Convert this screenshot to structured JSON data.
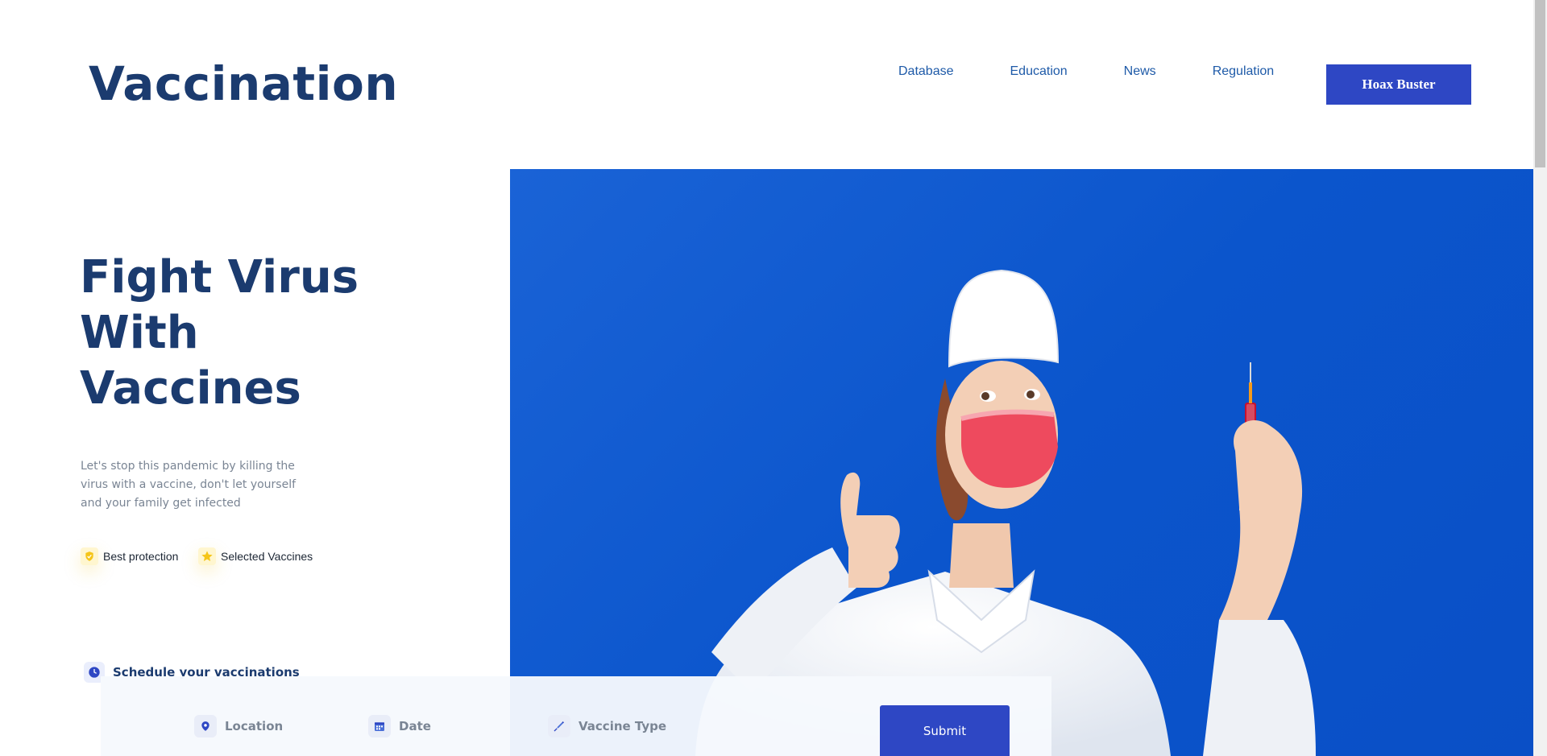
{
  "brand": {
    "logo_text": "Vaccination"
  },
  "nav": {
    "items": [
      {
        "label": "Database"
      },
      {
        "label": "Education"
      },
      {
        "label": "News"
      },
      {
        "label": "Regulation"
      }
    ],
    "cta_label": "Hoax Buster"
  },
  "hero": {
    "title_lines": [
      "Fight Virus",
      "With",
      "Vaccines"
    ],
    "description": "Let's stop this pandemic by killing the virus with a vaccine, don't let yourself and your family get infected",
    "features": [
      {
        "icon": "shield-check-icon",
        "label": "Best protection"
      },
      {
        "icon": "star-icon",
        "label": "Selected Vaccines"
      }
    ],
    "image": {
      "icon": "nurse-with-syringe-photo",
      "description": "Nurse in white coat and red mask giving thumbs up holding a syringe on blue background"
    }
  },
  "schedule": {
    "label": "Schedule your vaccinations",
    "fields": [
      {
        "icon": "location-pin-icon",
        "placeholder": "Location"
      },
      {
        "icon": "calendar-icon",
        "placeholder": "Date"
      },
      {
        "icon": "syringe-icon",
        "placeholder": "Vaccine Type"
      }
    ],
    "submit_label": "Submit"
  },
  "colors": {
    "primary_navy": "#1b3b6f",
    "accent_blue": "#2e47c4",
    "hero_bg_blue": "#0b55cc",
    "feature_yellow": "#f5c518",
    "muted_text": "#7a8594"
  }
}
